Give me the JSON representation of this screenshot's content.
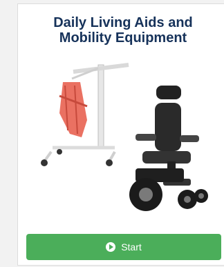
{
  "card": {
    "title_line1": "Daily Living Aids and",
    "title_line2": "Mobility Equipment",
    "image_icons": [
      "patient-lift-icon",
      "power-wheelchair-icon"
    ],
    "start_button": {
      "label": "Start",
      "icon": "play-circle-icon",
      "color": "#4bae5a"
    },
    "title_color": "#16325a"
  }
}
